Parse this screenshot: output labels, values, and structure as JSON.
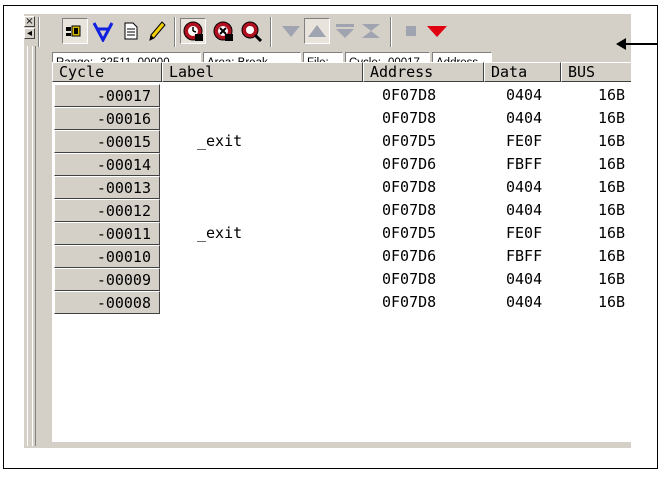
{
  "window": {
    "dock_close_glyph": "×",
    "dock_arrow_glyph": "◂"
  },
  "toolbar": {
    "buttons": [
      {
        "name": "trace-display-icon",
        "selected": true
      },
      {
        "name": "filter-v-icon"
      },
      {
        "name": "document-icon"
      },
      {
        "name": "pencil-icon"
      },
      {
        "name": "trace-start-icon",
        "selected": true
      },
      {
        "name": "trace-stop-icon"
      },
      {
        "name": "trace-search-icon"
      },
      {
        "name": "down-triangle-icon"
      },
      {
        "name": "up-triangle-icon",
        "selected": true
      },
      {
        "name": "bottom-triangle-icon"
      },
      {
        "name": "collapse-icon"
      },
      {
        "name": "square-icon"
      },
      {
        "name": "red-triangle-icon"
      }
    ],
    "accent_red": "#e00010",
    "accent_blue": "#1020e0"
  },
  "status": {
    "range": "Range: -32511,  00000",
    "area": "Area: Break",
    "file": "File:",
    "cycle": "Cycle: -00017",
    "address": "Address"
  },
  "grid": {
    "headers": {
      "cycle": "Cycle",
      "label": "Label",
      "address": "Address",
      "data": "Data",
      "bus": "BUS"
    },
    "rows": [
      {
        "cycle": "-00017",
        "label": "",
        "address": "0F07D8",
        "data": "0404",
        "bus": "16B"
      },
      {
        "cycle": "-00016",
        "label": "",
        "address": "0F07D8",
        "data": "0404",
        "bus": "16B"
      },
      {
        "cycle": "-00015",
        "label": "_exit",
        "address": "0F07D5",
        "data": "FE0F",
        "bus": "16B"
      },
      {
        "cycle": "-00014",
        "label": "",
        "address": "0F07D6",
        "data": "FBFF",
        "bus": "16B"
      },
      {
        "cycle": "-00013",
        "label": "",
        "address": "0F07D8",
        "data": "0404",
        "bus": "16B"
      },
      {
        "cycle": "-00012",
        "label": "",
        "address": "0F07D8",
        "data": "0404",
        "bus": "16B"
      },
      {
        "cycle": "-00011",
        "label": "_exit",
        "address": "0F07D5",
        "data": "FE0F",
        "bus": "16B"
      },
      {
        "cycle": "-00010",
        "label": "",
        "address": "0F07D6",
        "data": "FBFF",
        "bus": "16B"
      },
      {
        "cycle": "-00009",
        "label": "",
        "address": "0F07D8",
        "data": "0404",
        "bus": "16B"
      },
      {
        "cycle": "-00008",
        "label": "",
        "address": "0F07D8",
        "data": "0404",
        "bus": "16B"
      }
    ]
  }
}
